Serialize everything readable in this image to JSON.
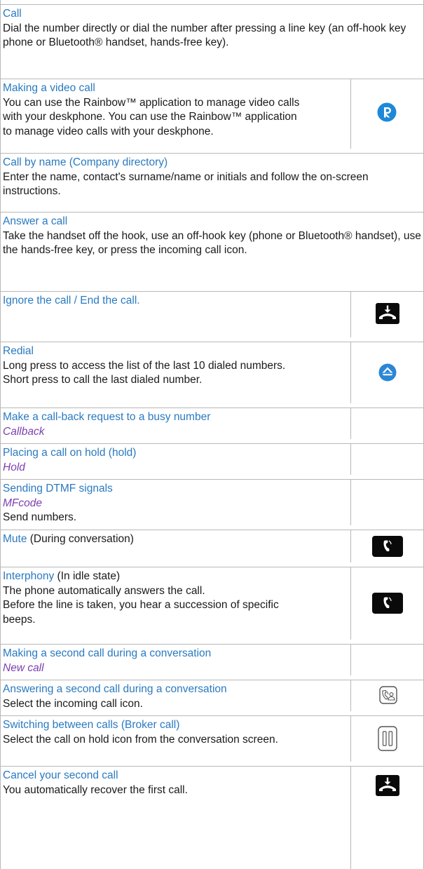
{
  "rows": [
    {
      "title": "Call",
      "body": [
        "Dial the number directly or dial the number after pressing a line key (an off-hook key phone or Bluetooth® handset, hands-free key)."
      ]
    },
    {
      "title": "Making a video call",
      "body": [
        "You can use the Rainbow™ application to manage video calls with your deskphone. You can use the Rainbow™ application to manage video calls with your deskphone."
      ],
      "icon": "rainbow-r-icon"
    },
    {
      "title": "Call by name (Company directory)",
      "body": [
        "Enter the name, contact's surname/name or initials and follow the on-screen instructions."
      ]
    },
    {
      "title": "Answer a call",
      "body": [
        "Take the handset off the hook, use an off-hook key (phone or Bluetooth® handset), use the hands-free key, or press the incoming call icon."
      ]
    },
    {
      "title": "Ignore the call / End the call.",
      "icon": "hang-up-icon"
    },
    {
      "title": "Redial",
      "body": [
        "Long press to access the list of the last 10 dialed numbers.",
        "Short press to call the last dialed number."
      ],
      "icon": "redial-icon"
    },
    {
      "title": "Make a call-back request to a busy number",
      "softkey": "Callback"
    },
    {
      "title": "Placing a call on hold (hold)",
      "softkey": "Hold"
    },
    {
      "title": "Sending DTMF signals",
      "softkey": "MFcode",
      "body": [
        "Send numbers."
      ]
    },
    {
      "title": "Mute",
      "note": " (During conversation)",
      "icon": "mute-key-icon"
    },
    {
      "title": "Interphony",
      "note": " (In idle state)",
      "body": [
        "The phone automatically answers the call.",
        "Before the line is taken, you hear a succession of specific beeps."
      ],
      "icon": "interphony-key-icon"
    },
    {
      "title": "Making a second call during a conversation",
      "softkey": "New call"
    },
    {
      "title": "Answering a second call during a conversation",
      "body": [
        "Select the incoming call icon."
      ],
      "icon": "incoming-call-icon"
    },
    {
      "title": "Switching between calls (Broker call)",
      "body": [
        "Select the call on hold icon from the conversation screen."
      ],
      "icon": "hold-icon"
    },
    {
      "title": "Cancel your second call",
      "body": [
        "You automatically recover the first call."
      ],
      "icon": "hang-up-icon"
    }
  ],
  "colors": {
    "title": "#2a7ac0",
    "softkey": "#7c3fb0",
    "rainbow": "#1e88d8",
    "redial": "#2b86d6",
    "grid": "#b8b8b8"
  }
}
